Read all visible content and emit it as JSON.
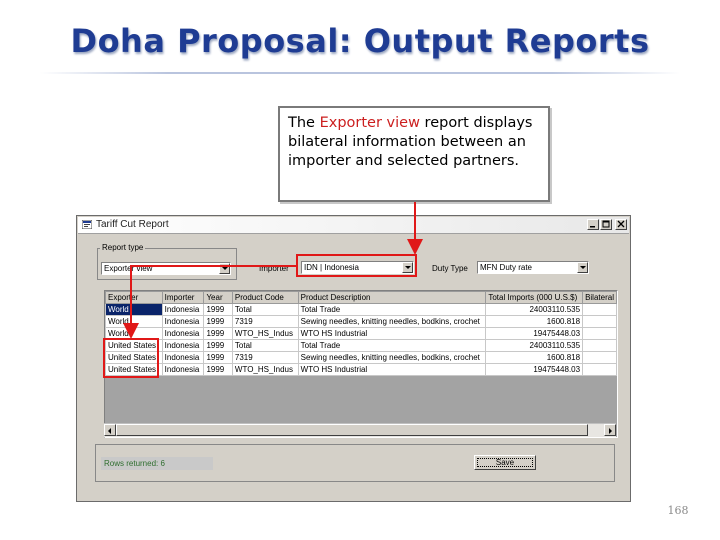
{
  "slide": {
    "title": "Doha Proposal: Output Reports",
    "callout": {
      "pre": "The ",
      "highlight": "Exporter view",
      "post": " report displays bilateral information between an importer and selected partners."
    },
    "page_number": "168"
  },
  "window": {
    "title": "Tariff Cut Report",
    "report_type_label": "Report type",
    "report_type_value": "Exporter view",
    "importer_label": "Importer",
    "importer_value": "IDN | Indonesia",
    "duty_type_label": "Duty Type",
    "duty_type_value": "MFN Duty rate",
    "table": {
      "columns": [
        "Exporter",
        "Importer",
        "Year",
        "Product Code",
        "Product Description",
        "Total Imports (000 U.S.$)",
        "Bilateral"
      ],
      "rows": [
        [
          "World",
          "Indonesia",
          "1999",
          "Total",
          "Total Trade",
          "24003110.535",
          ""
        ],
        [
          "World",
          "Indonesia",
          "1999",
          "7319",
          "Sewing needles, knitting needles, bodkins, crochet",
          "1600.818",
          ""
        ],
        [
          "World",
          "Indonesia",
          "1999",
          "WTO_HS_Indus",
          "WTO HS Industrial",
          "19475448.03",
          ""
        ],
        [
          "United States",
          "Indonesia",
          "1999",
          "Total",
          "Total Trade",
          "24003110.535",
          ""
        ],
        [
          "United States",
          "Indonesia",
          "1999",
          "7319",
          "Sewing needles, knitting needles, bodkins, crochet",
          "1600.818",
          ""
        ],
        [
          "United States",
          "Indonesia",
          "1999",
          "WTO_HS_Indus",
          "WTO HS Industrial",
          "19475448.03",
          ""
        ]
      ]
    },
    "status_text": "Rows returned: 6",
    "save_label": "Save"
  },
  "colors": {
    "title": "#1f3c93",
    "highlight": "#cc1f1f",
    "annotation": "#e01818",
    "window_bg": "#d4d0c8"
  }
}
